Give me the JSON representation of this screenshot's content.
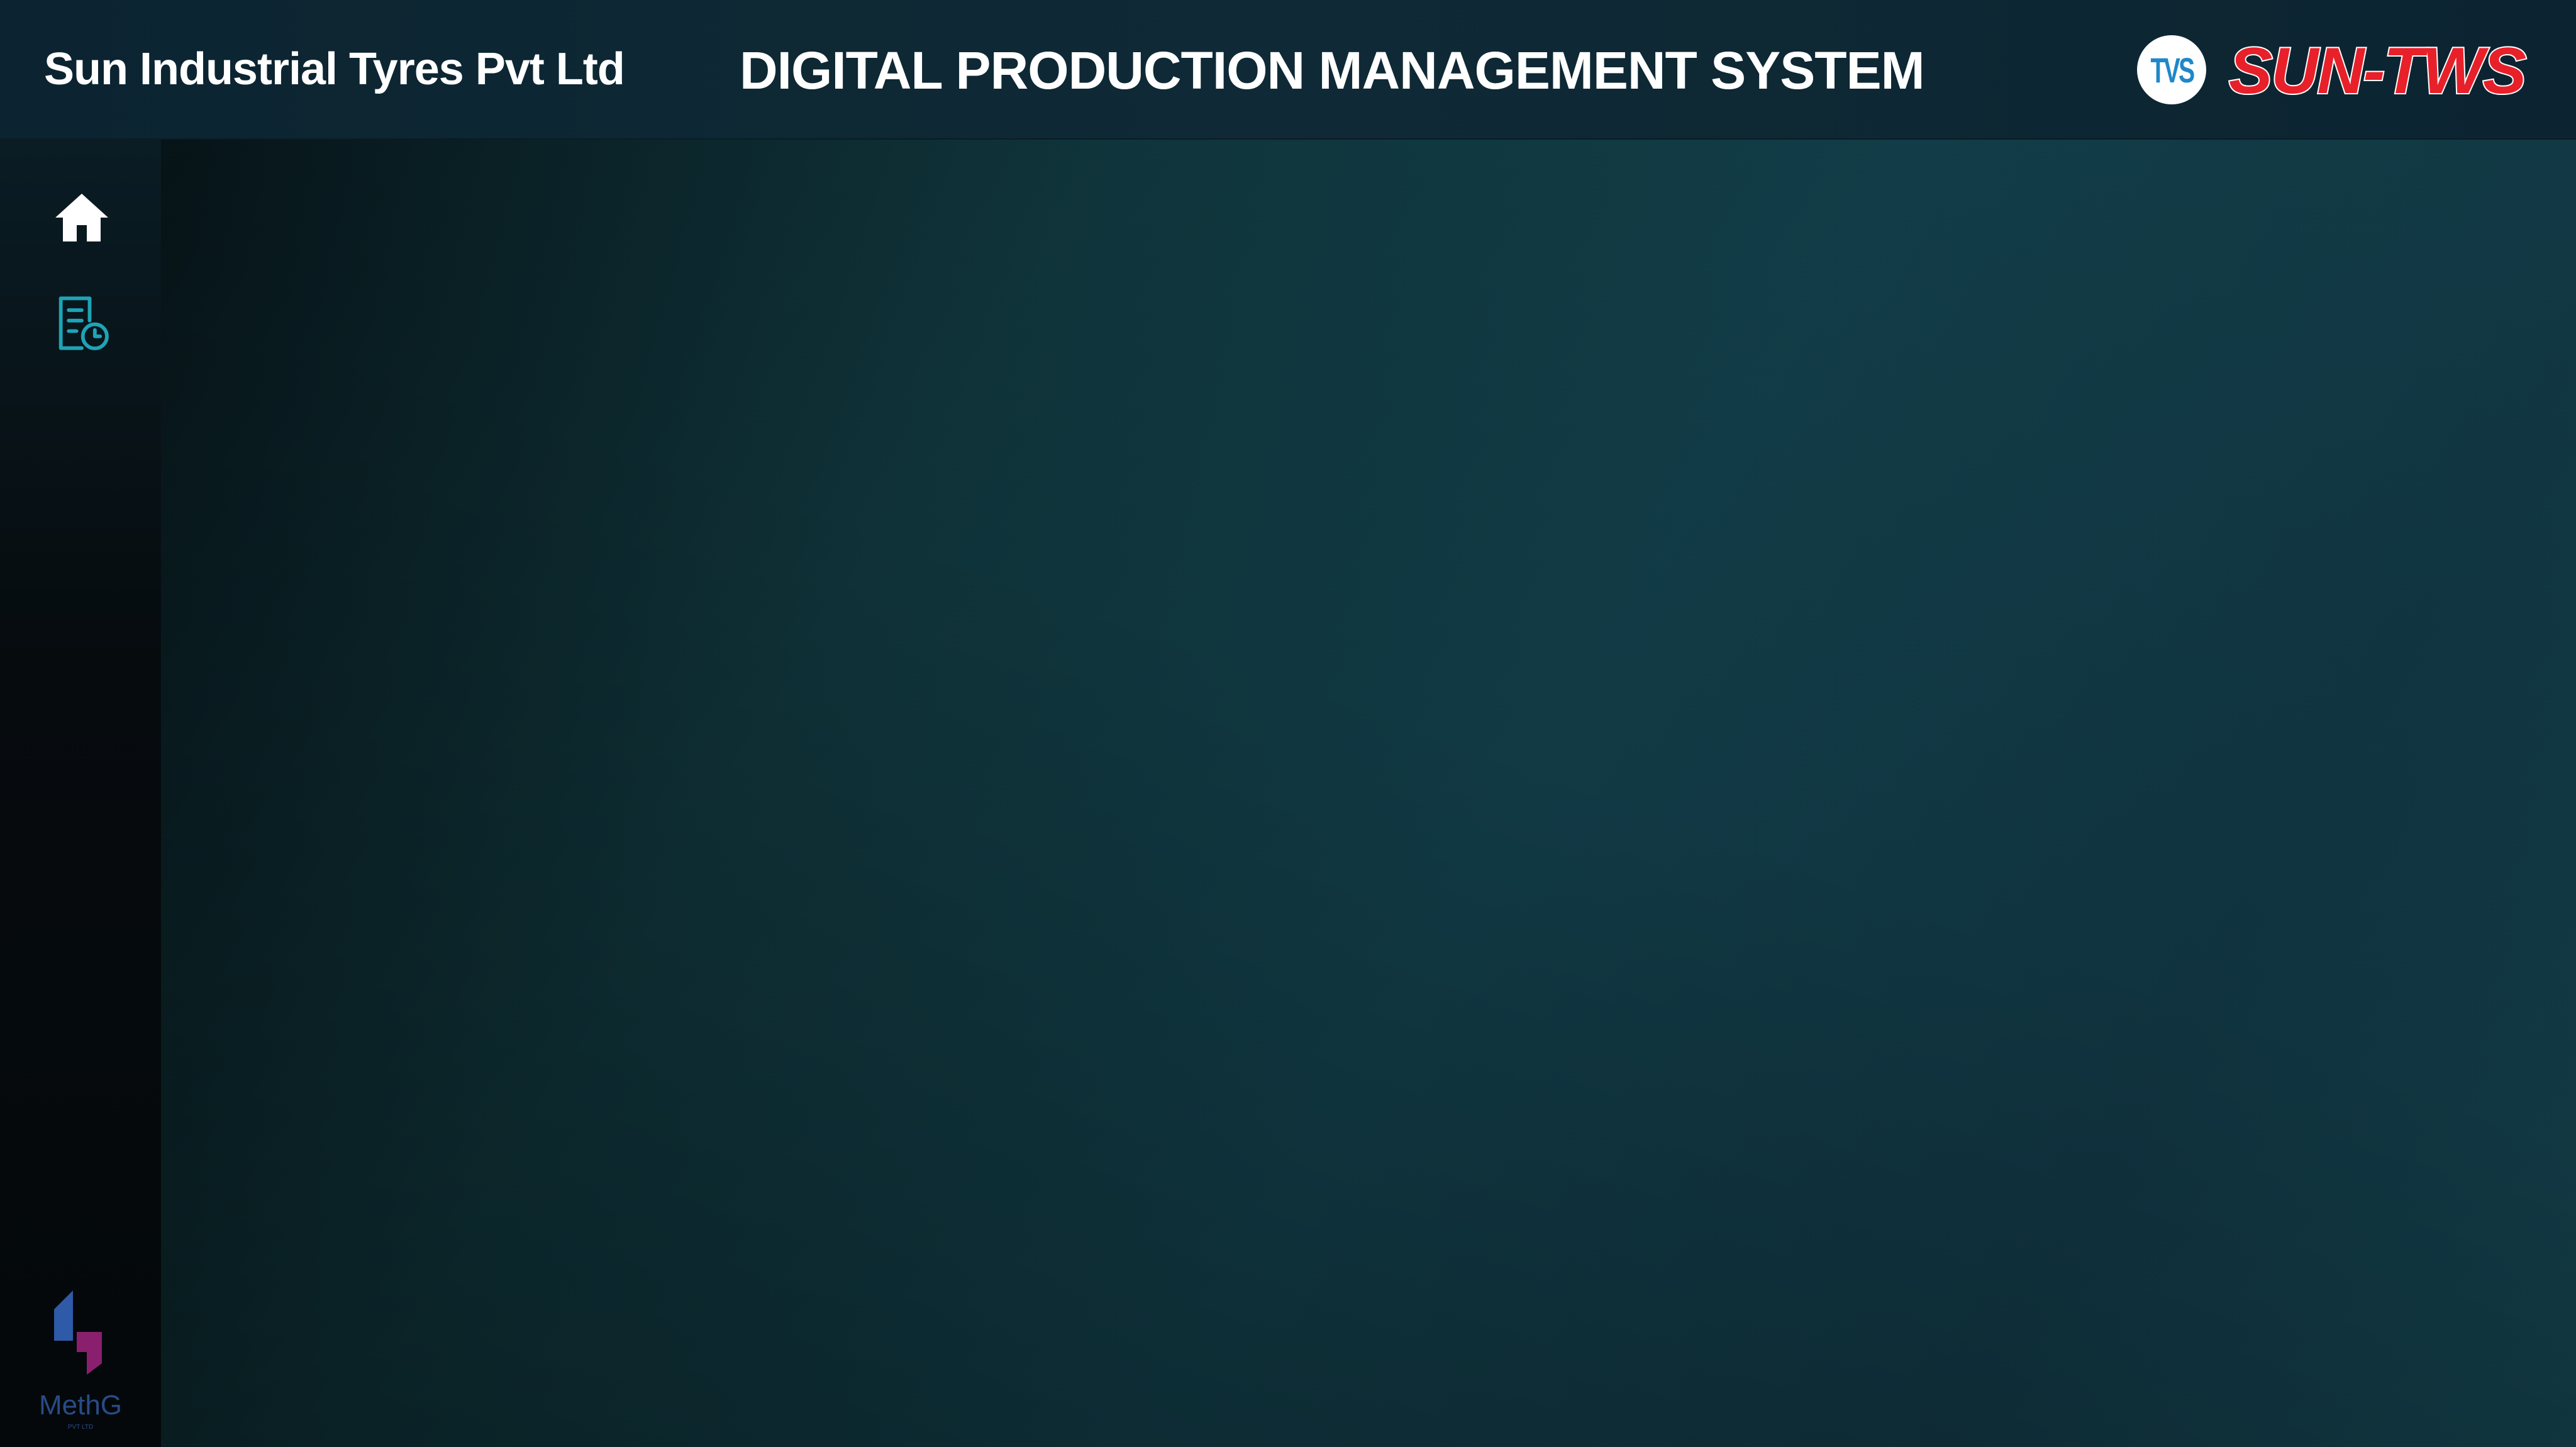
{
  "header": {
    "company_name": "Sun Industrial Tyres Pvt Ltd",
    "title": "DIGITAL PRODUCTION MANAGEMENT SYSTEM",
    "tvs_logo_text": "TVS",
    "brand_logo_text": "SUN-TWS"
  },
  "sidebar": {
    "items": [
      {
        "name": "home",
        "icon": "home-icon"
      },
      {
        "name": "history",
        "icon": "report-clock-icon"
      }
    ],
    "footer_logo": {
      "label": "MethG",
      "sub": "PVT LTD"
    }
  },
  "colors": {
    "header_bg": "#0f2a36",
    "sidebar_bg": "#060b0e",
    "main_bg": "#113a45",
    "text": "#ffffff",
    "accent_teal": "#1fa3b6",
    "brand_red": "#e8202a",
    "tvs_blue": "#1e88c8"
  }
}
